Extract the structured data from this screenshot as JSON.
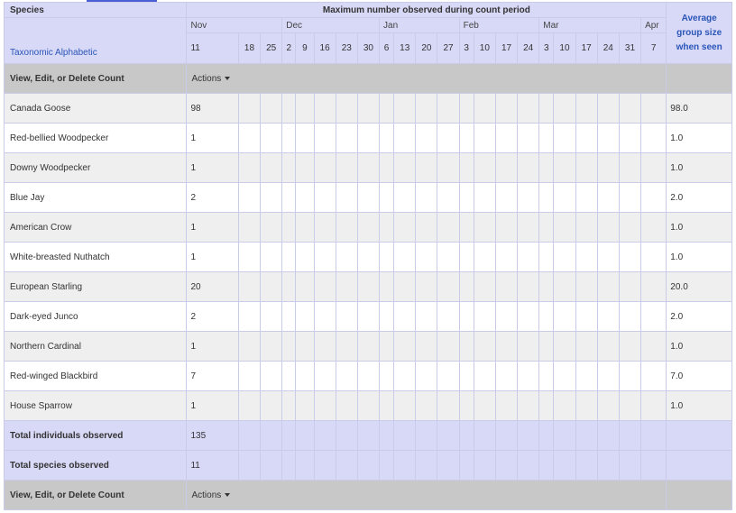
{
  "header": {
    "species_label": "Species",
    "sort_label": "Taxonomic Alphabetic",
    "period_title": "Maximum number observed during count period",
    "avg_label_1": "Average",
    "avg_label_2": "group size",
    "avg_label_3": "when seen"
  },
  "months": [
    "Nov",
    "Dec",
    "Jan",
    "Feb",
    "Mar",
    "Apr"
  ],
  "days": [
    "11",
    "18",
    "25",
    "2",
    "9",
    "16",
    "23",
    "30",
    "6",
    "13",
    "20",
    "27",
    "3",
    "10",
    "17",
    "24",
    "3",
    "10",
    "17",
    "24",
    "31",
    "7"
  ],
  "actions_row": {
    "label": "View, Edit, or Delete Count",
    "button": "Actions"
  },
  "species": [
    {
      "name": "Canada Goose",
      "count": "98",
      "avg": "98.0"
    },
    {
      "name": "Red-bellied Woodpecker",
      "count": "1",
      "avg": "1.0"
    },
    {
      "name": "Downy Woodpecker",
      "count": "1",
      "avg": "1.0"
    },
    {
      "name": "Blue Jay",
      "count": "2",
      "avg": "2.0"
    },
    {
      "name": "American Crow",
      "count": "1",
      "avg": "1.0"
    },
    {
      "name": "White-breasted Nuthatch",
      "count": "1",
      "avg": "1.0"
    },
    {
      "name": "European Starling",
      "count": "20",
      "avg": "20.0"
    },
    {
      "name": "Dark-eyed Junco",
      "count": "2",
      "avg": "2.0"
    },
    {
      "name": "Northern Cardinal",
      "count": "1",
      "avg": "1.0"
    },
    {
      "name": "Red-winged Blackbird",
      "count": "7",
      "avg": "7.0"
    },
    {
      "name": "House Sparrow",
      "count": "1",
      "avg": "1.0"
    }
  ],
  "totals": {
    "individuals_label": "Total individuals observed",
    "individuals": "135",
    "species_label": "Total species observed",
    "species": "11"
  }
}
